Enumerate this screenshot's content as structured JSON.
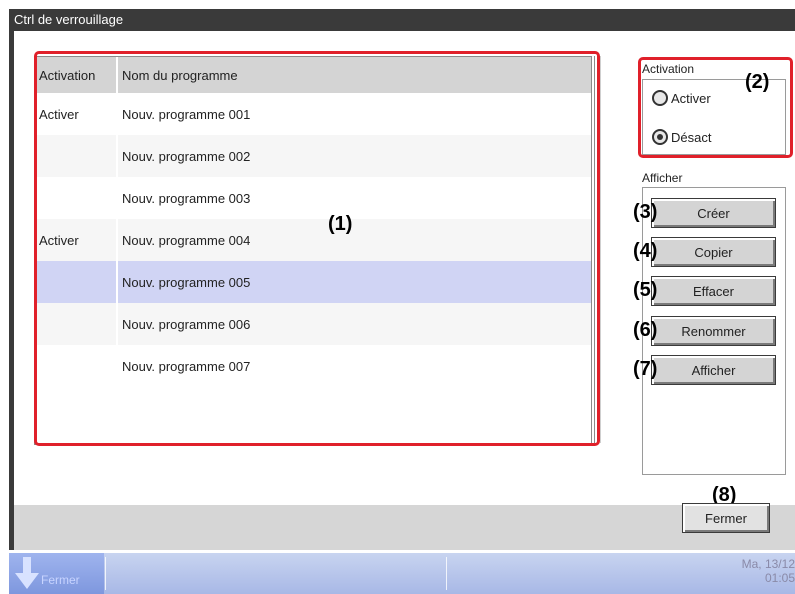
{
  "window": {
    "title": "Ctrl de verrouillage"
  },
  "table": {
    "headers": [
      "Activation",
      "Nom du programme"
    ],
    "rows": [
      {
        "activation": "Activer",
        "name": "Nouv. programme 001"
      },
      {
        "activation": "",
        "name": "Nouv. programme 002"
      },
      {
        "activation": "",
        "name": "Nouv. programme 003"
      },
      {
        "activation": "Activer",
        "name": "Nouv. programme 004"
      },
      {
        "activation": "",
        "name": "Nouv. programme 005"
      },
      {
        "activation": "",
        "name": "Nouv. programme 006"
      },
      {
        "activation": "",
        "name": "Nouv. programme 007"
      }
    ],
    "selected_row": 4
  },
  "activation_group": {
    "label": "Activation",
    "options": [
      "Activer",
      "Désact"
    ],
    "selected": "Désact"
  },
  "display_group": {
    "label": "Afficher",
    "buttons": [
      "Créer",
      "Copier",
      "Effacer",
      "Renommer",
      "Afficher"
    ]
  },
  "close_button": "Fermer",
  "callouts": [
    "(1)",
    "(2)",
    "(3)",
    "(4)",
    "(5)",
    "(6)",
    "(7)",
    "(8)"
  ],
  "taskbar": {
    "start_label": "Fermer",
    "clock_date": "Ma, 13/12",
    "clock_time": "01:05"
  },
  "colors": {
    "highlight_red": "#e0202a",
    "selected_row": "#d0d4f4",
    "title_bar": "#3a3a3a"
  }
}
